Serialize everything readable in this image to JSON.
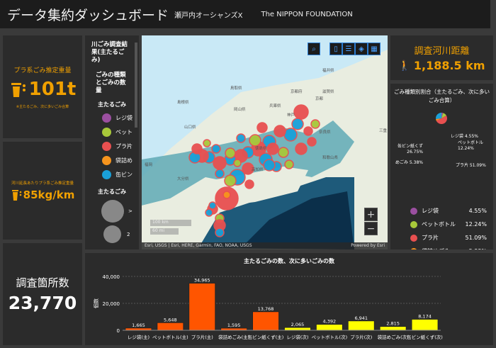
{
  "header": {
    "title": "データ集約ダッシュボード",
    "subtitle": "瀬戸内オーシャンズX",
    "partner": "The NIPPON FOUNDATION"
  },
  "card_weight": {
    "label": "プラ系ごみ推定重量",
    "value": "101t",
    "note": "※主たるごみ、次に多いごみ合算",
    "icon": "trash-icon"
  },
  "card_per_km": {
    "label": "河川延長あたりプラ系ごみ推定重量",
    "value": "85kg/km",
    "icon": "trash-icon"
  },
  "card_sites": {
    "label": "調査箇所数",
    "value": "23,770"
  },
  "legend": {
    "title": "川ごみ調査結果(主たるごみ)",
    "subtitle": "ごみの種類とごみの数量",
    "section1": "主たるごみ",
    "items": [
      {
        "label": "レジ袋",
        "color": "#9b4fa0"
      },
      {
        "label": "ペット",
        "color": "#a8c83a"
      },
      {
        "label": "プラ片",
        "color": "#e85050"
      },
      {
        "label": "袋詰め",
        "color": "#f7941d"
      },
      {
        "label": "缶ビン",
        "color": "#1aa0d8"
      }
    ],
    "section2": "主たるごみ",
    "sizes": [
      ">",
      "2"
    ]
  },
  "map": {
    "attribution": "Esri, USGS | Esri, HERE, Garmin, FAO, NOAA, USGS",
    "powered": "Powered by Esri",
    "scale_km": "100 km",
    "scale_mi": "60 mi",
    "places": [
      "鳥取県",
      "島根県",
      "岡山県",
      "兵庫県",
      "京都府",
      "京都",
      "滋賀県",
      "福井県",
      "神戸",
      "山口県",
      "徳島県",
      "高知県",
      "奈良県",
      "和歌山県",
      "大分県",
      "福岡",
      "三重"
    ],
    "tools": [
      "search-icon",
      "bookmark-icon",
      "list-icon",
      "layers-icon",
      "basemap-icon"
    ],
    "zoom_in": "+",
    "zoom_out": "−"
  },
  "distance": {
    "label": "調査河川距離",
    "value": "1,188.5 km",
    "icon": "walker-icon"
  },
  "pie": {
    "title": "ごみ種類別割合（主たるごみ、次に多いごみ合算）",
    "slices": [
      {
        "label": "レジ袋",
        "pct": 4.55,
        "text": "4.55%",
        "color": "#9b4fa0"
      },
      {
        "label": "ペットボトル",
        "pct": 12.24,
        "text": "12.24%",
        "color": "#a8c83a"
      },
      {
        "label": "プラ片",
        "pct": 51.09,
        "text": "51.09%",
        "color": "#e85050"
      },
      {
        "label": "袋詰めごみ",
        "pct": 5.38,
        "text": "5.38%",
        "color": "#f7941d"
      },
      {
        "label": "缶ビン紙くず",
        "pct": 26.75,
        "text": "26.75%",
        "color": "#1aa0d8"
      }
    ],
    "callouts": {
      "a": "レジ袋 4.55%",
      "b1": "ペットボトル",
      "b2": "12.24%",
      "c": "プラ片 51.09%",
      "d": "めごみ 5.38%",
      "e1": "缶ビン紙くず",
      "e2": "26.75%"
    }
  },
  "chart_data": {
    "type": "bar",
    "title": "主たるごみの数、次に多いごみの数",
    "ylabel": "個数",
    "ylim": [
      0,
      40000
    ],
    "yticks": [
      "0",
      "20,000",
      "40,000"
    ],
    "grid": true,
    "categories": [
      "レジ袋(主)",
      "ペットボトル(主)",
      "プラ片(主)",
      "袋詰めごみ(主)",
      "缶ビン紙くず(主)",
      "レジ袋(次)",
      "ペットボトル(次)",
      "プラ片(次)",
      "袋詰めごみ(次)",
      "缶ビン紙くず(次)"
    ],
    "values": [
      1665,
      5648,
      34965,
      1595,
      13768,
      2065,
      4392,
      6941,
      2815,
      8174
    ],
    "labels": [
      "1,665",
      "5,648",
      "34,965",
      "1,595",
      "13,768",
      "2,065",
      "4,392",
      "6,941",
      "2,815",
      "8,174"
    ],
    "colors": [
      "#ff5500",
      "#ff5500",
      "#ff5500",
      "#ff5500",
      "#ff5500",
      "#ffff00",
      "#ffff00",
      "#ffff00",
      "#ffff00",
      "#ffff00"
    ]
  }
}
